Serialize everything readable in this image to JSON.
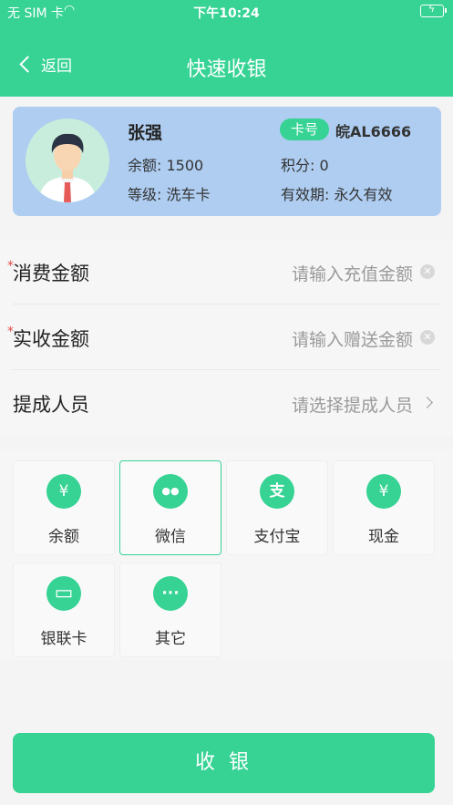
{
  "status_bar": {
    "carrier": "无 SIM 卡",
    "time": "下午10:24"
  },
  "nav": {
    "back_label": "返回",
    "title": "快速收银"
  },
  "member": {
    "name": "张强",
    "balance": "余额: 1500",
    "level": "等级: 洗车卡",
    "card_tag": "卡号",
    "card_no": "皖AL6666",
    "points": "积分: 0",
    "validity": "有效期: 永久有效"
  },
  "form": {
    "consume": {
      "label": "消费金额",
      "placeholder": "请输入充值金额"
    },
    "received": {
      "label": "实收金额",
      "placeholder": "请输入赠送金额"
    },
    "staff": {
      "label": "提成人员",
      "placeholder": "请选择提成人员"
    }
  },
  "payment_methods": [
    {
      "label": "余额",
      "icon": "yen-icon",
      "glyph": "¥"
    },
    {
      "label": "微信",
      "icon": "wechat-icon",
      "glyph": "●●"
    },
    {
      "label": "支付宝",
      "icon": "alipay-icon",
      "glyph": "支"
    },
    {
      "label": "现金",
      "icon": "money-bag-icon",
      "glyph": "¥"
    },
    {
      "label": "银联卡",
      "icon": "bank-card-icon",
      "glyph": "▭"
    },
    {
      "label": "其它",
      "icon": "more-icon",
      "glyph": "···"
    }
  ],
  "selected_payment": "微信",
  "submit": {
    "label": "收 银"
  },
  "colors": {
    "accent": "#36d394",
    "card": "#aecdf1",
    "required": "#e6494a"
  }
}
